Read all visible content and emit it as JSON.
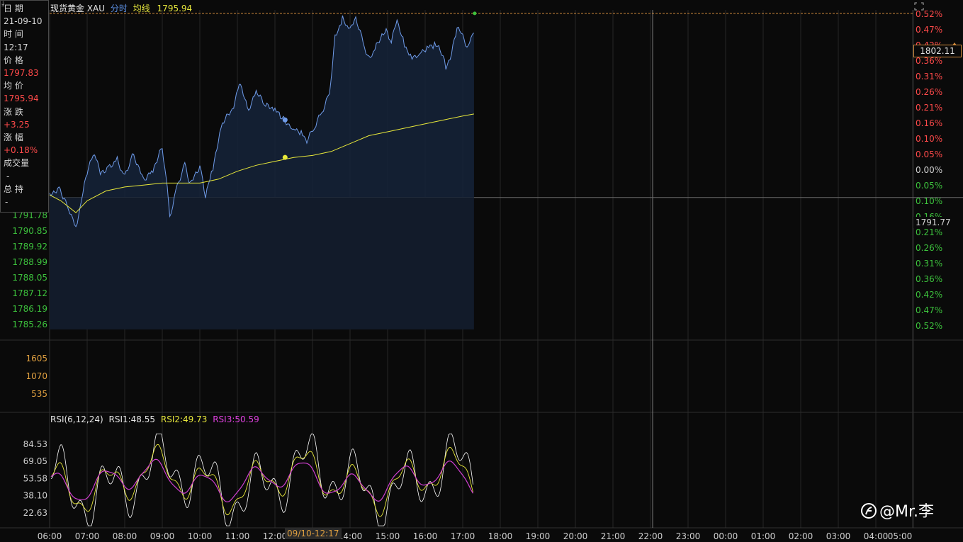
{
  "header": {
    "name": "现货黄金 XAU",
    "tab": "分时",
    "avg_label": "均线",
    "avg_value": "1795.94"
  },
  "info_panel": {
    "date_label": "日 期",
    "date_value": "21-09-10",
    "time_label": "时 间",
    "time_value": "12:17",
    "price_label": "价 格",
    "price_value": "1797.83",
    "avg_label": "均 价",
    "avg_value": "1795.94",
    "change_label": "涨 跌",
    "change_value": "+3.25",
    "pct_label": "涨 幅",
    "pct_value": "+0.18%",
    "volume_label": "成交量",
    "volume_value": "-",
    "oi_label": "总 持",
    "oi_value": "-"
  },
  "current_price": "1802.11",
  "prev_close_label": "1791.77",
  "crosshair_time": "09/10-12:17",
  "rsi_header": {
    "params": "RSI(6,12,24)",
    "rsi1": "RSI1:48.55",
    "rsi2": "RSI2:49.73",
    "rsi3": "RSI3:50.59"
  },
  "watermark": "@Mr.李",
  "colors": {
    "up": "#ff4a4a",
    "down": "#3dc23d",
    "price_line": "#6f9be8",
    "avg_line": "#e8e83a",
    "rsi1": "#ffffff",
    "rsi2": "#e8e83a",
    "rsi3": "#d040d0",
    "grid": "#262626",
    "vol_axis": "#e0a040"
  },
  "chart_data": {
    "type": "line",
    "x_ticks": [
      "06:00",
      "07:00",
      "08:00",
      "09:00",
      "10:00",
      "11:00",
      "12:00",
      "13:00",
      "14:00",
      "15:00",
      "16:00",
      "17:00",
      "18:00",
      "19:00",
      "20:00",
      "21:00",
      "22:00",
      "23:00",
      "00:00",
      "01:00",
      "02:00",
      "03:00",
      "04:00",
      "05:00"
    ],
    "y_left_ticks_below": [
      "1791.78",
      "1790.85",
      "1789.92",
      "1788.99",
      "1788.05",
      "1787.12",
      "1786.19",
      "1785.26"
    ],
    "y_right_ticks_up": [
      "0.52%",
      "0.47%",
      "0.42%",
      "0.36%",
      "0.31%",
      "0.26%",
      "0.21%",
      "0.16%",
      "0.10%",
      "0.05%",
      "0.00%"
    ],
    "y_right_ticks_down": [
      "0.05%",
      "0.10%",
      "0.16%",
      "0.21%",
      "0.26%",
      "0.31%",
      "0.36%",
      "0.42%",
      "0.47%",
      "0.52%"
    ],
    "prev_close": 1791.77,
    "price_range": [
      1785.26,
      1801.06
    ],
    "price_series": [
      [
        0,
        1791.9
      ],
      [
        0.25,
        1792.3
      ],
      [
        0.5,
        1791.3
      ],
      [
        0.7,
        1790.3
      ],
      [
        0.85,
        1791.6
      ],
      [
        1.0,
        1793.1
      ],
      [
        1.2,
        1794.1
      ],
      [
        1.35,
        1793.0
      ],
      [
        1.6,
        1793.4
      ],
      [
        1.8,
        1793.7
      ],
      [
        2.0,
        1792.8
      ],
      [
        2.2,
        1793.9
      ],
      [
        2.35,
        1793.4
      ],
      [
        2.5,
        1792.7
      ],
      [
        2.75,
        1793.2
      ],
      [
        3.0,
        1794.3
      ],
      [
        3.1,
        1792.8
      ],
      [
        3.2,
        1790.8
      ],
      [
        3.4,
        1792.4
      ],
      [
        3.6,
        1793.5
      ],
      [
        3.75,
        1792.4
      ],
      [
        4.0,
        1793.4
      ],
      [
        4.15,
        1791.8
      ],
      [
        4.35,
        1793.3
      ],
      [
        4.6,
        1795.5
      ],
      [
        4.9,
        1796.3
      ],
      [
        5.05,
        1797.6
      ],
      [
        5.3,
        1796.1
      ],
      [
        5.5,
        1797.1
      ],
      [
        5.75,
        1796.4
      ],
      [
        6.0,
        1796.2
      ],
      [
        6.15,
        1795.9
      ],
      [
        6.3,
        1795.6
      ],
      [
        6.5,
        1795.3
      ],
      [
        6.7,
        1795.1
      ],
      [
        6.85,
        1794.6
      ],
      [
        7.05,
        1795.3
      ],
      [
        7.25,
        1796.1
      ],
      [
        7.45,
        1797.0
      ],
      [
        7.6,
        1799.9
      ],
      [
        7.8,
        1800.8
      ],
      [
        8.0,
        1800.2
      ],
      [
        8.15,
        1800.9
      ],
      [
        8.35,
        1799.6
      ],
      [
        8.5,
        1798.8
      ],
      [
        8.7,
        1799.4
      ],
      [
        8.85,
        1800.0
      ],
      [
        9.0,
        1800.2
      ],
      [
        9.1,
        1799.6
      ],
      [
        9.25,
        1800.8
      ],
      [
        9.45,
        1799.5
      ],
      [
        9.65,
        1798.9
      ],
      [
        9.85,
        1799.1
      ],
      [
        10.05,
        1799.4
      ],
      [
        10.25,
        1799.5
      ],
      [
        10.4,
        1799.3
      ],
      [
        10.55,
        1798.4
      ],
      [
        10.7,
        1799.0
      ],
      [
        10.85,
        1800.4
      ],
      [
        11.0,
        1800.0
      ],
      [
        11.15,
        1799.3
      ],
      [
        11.25,
        1800.2
      ],
      [
        11.3,
        1800.1
      ]
    ],
    "avg_series": [
      [
        0,
        1791.9
      ],
      [
        0.3,
        1791.6
      ],
      [
        0.7,
        1791.0
      ],
      [
        1.0,
        1791.6
      ],
      [
        1.5,
        1792.1
      ],
      [
        2.0,
        1792.3
      ],
      [
        2.5,
        1792.4
      ],
      [
        3.0,
        1792.5
      ],
      [
        3.5,
        1792.5
      ],
      [
        4.0,
        1792.5
      ],
      [
        4.5,
        1792.7
      ],
      [
        5.0,
        1793.1
      ],
      [
        5.5,
        1793.4
      ],
      [
        6.0,
        1793.6
      ],
      [
        6.5,
        1793.8
      ],
      [
        7.0,
        1793.9
      ],
      [
        7.5,
        1794.1
      ],
      [
        8.0,
        1794.5
      ],
      [
        8.5,
        1794.9
      ],
      [
        9.0,
        1795.1
      ],
      [
        9.5,
        1795.3
      ],
      [
        10.0,
        1795.5
      ],
      [
        10.5,
        1795.7
      ],
      [
        11.0,
        1795.9
      ],
      [
        11.3,
        1796.0
      ]
    ],
    "volume_ticks": [
      "1605",
      "1070",
      "535"
    ],
    "rsi_ticks": [
      "84.53",
      "69.05",
      "53.58",
      "38.10",
      "22.63"
    ],
    "rsi_range": [
      7,
      100
    ]
  }
}
